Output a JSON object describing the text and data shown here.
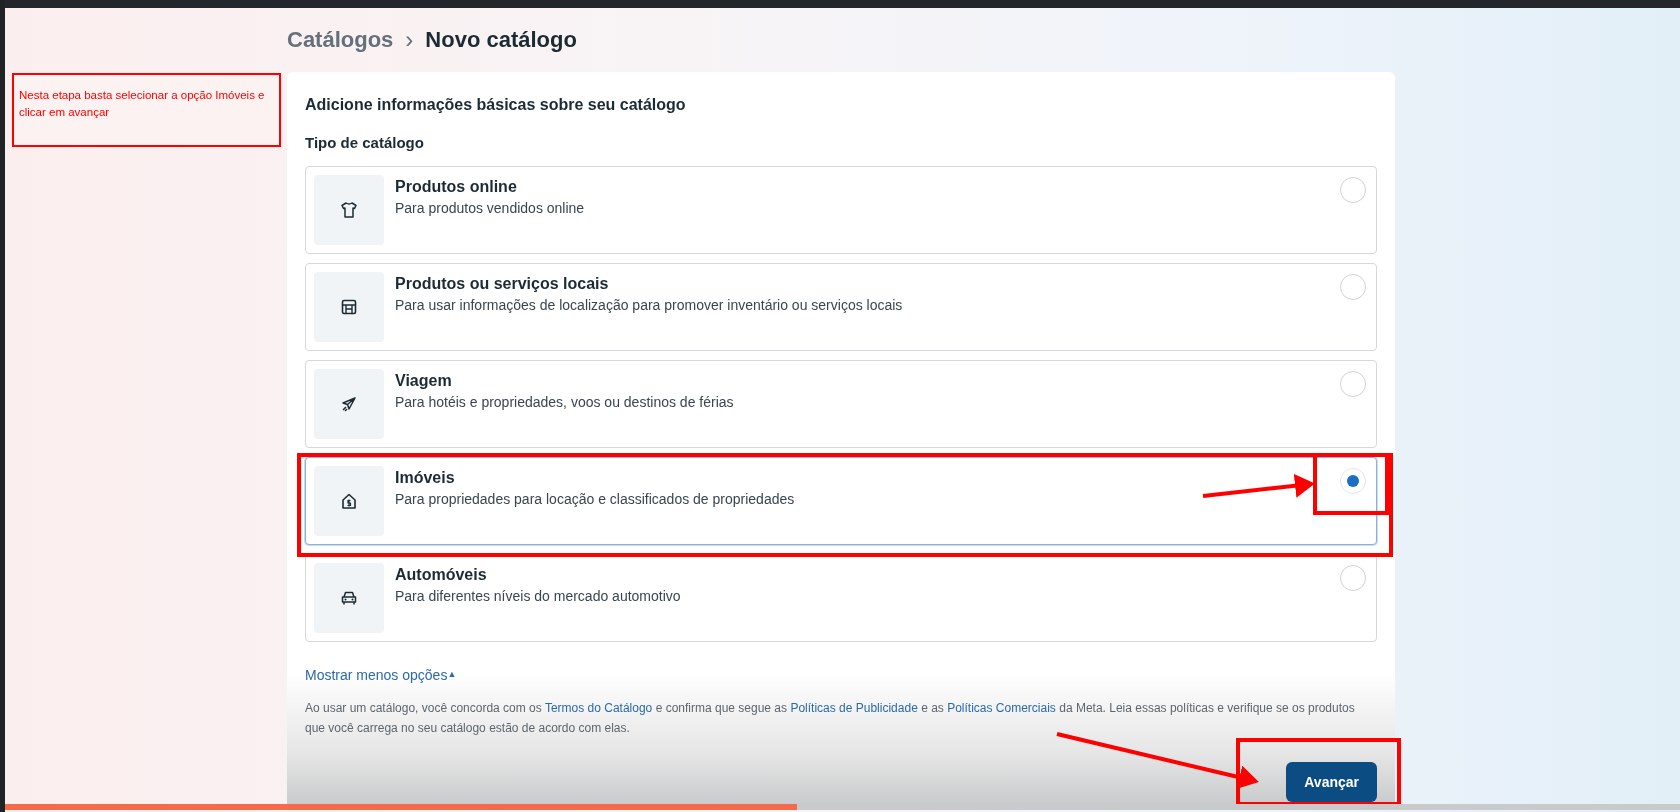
{
  "breadcrumb": {
    "parent": "Catálogos",
    "separator": "›",
    "current": "Novo catálogo"
  },
  "annotation_note": "Nesta etapa basta selecionar a opção Imóveis e clicar em avançar",
  "card": {
    "heading": "Adicione informações básicas sobre seu catálogo",
    "section_label": "Tipo de catálogo",
    "options": [
      {
        "title": "Produtos online",
        "description": "Para produtos vendidos online",
        "selected": false
      },
      {
        "title": "Produtos ou serviços locais",
        "description": "Para usar informações de localização para promover inventário ou serviços locais",
        "selected": false
      },
      {
        "title": "Viagem",
        "description": "Para hotéis e propriedades, voos ou destinos de férias",
        "selected": false
      },
      {
        "title": "Imóveis",
        "description": "Para propriedades para locação e classificados de propriedades",
        "selected": true
      },
      {
        "title": "Automóveis",
        "description": "Para diferentes níveis do mercado automotivo",
        "selected": false
      }
    ],
    "toggle_link": {
      "label": "Mostrar menos opções",
      "caret": "▲"
    },
    "legal_text": [
      {
        "kind": "text",
        "text": "Ao usar um catálogo, você concorda com os "
      },
      {
        "kind": "link",
        "text": "Termos do Catálogo"
      },
      {
        "kind": "text",
        "text": " e confirma que segue as "
      },
      {
        "kind": "link",
        "text": "Políticas de Publicidade"
      },
      {
        "kind": "text",
        "text": " e as "
      },
      {
        "kind": "link",
        "text": "Políticas Comerciais"
      },
      {
        "kind": "text",
        "text": " da Meta. Leia essas políticas e verifique se os produtos que você carrega no seu catálogo estão de acordo com elas."
      }
    ],
    "next_button": "Avançar"
  },
  "video_progress": {
    "level": 0.473
  }
}
